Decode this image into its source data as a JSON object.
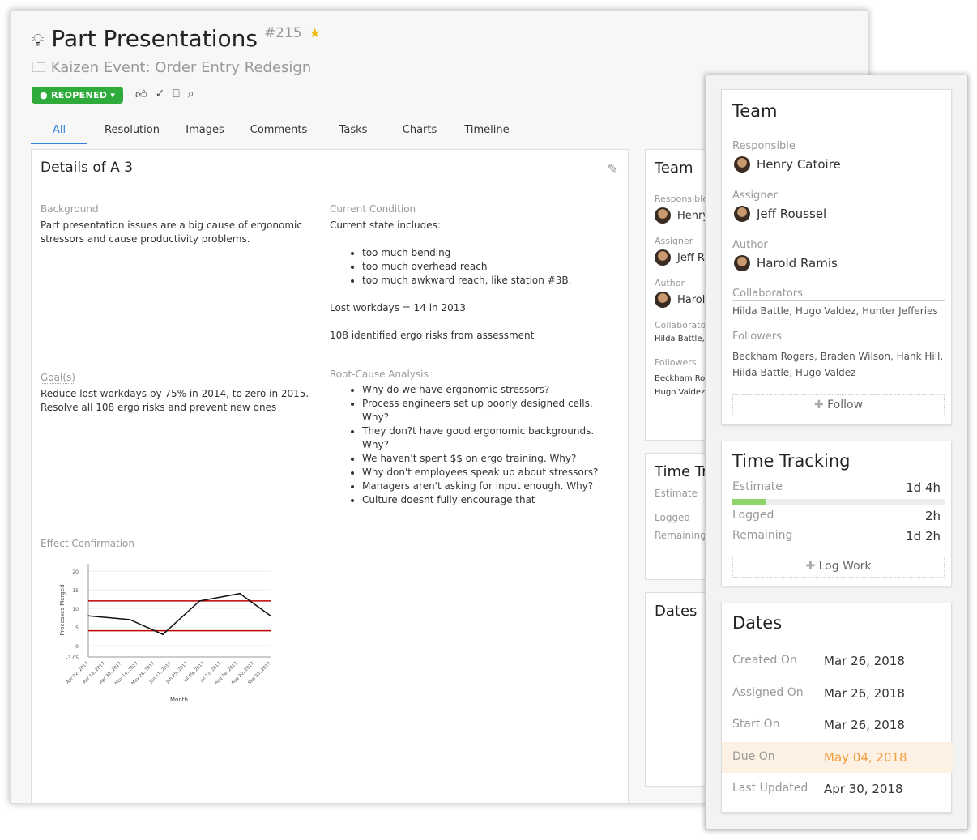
{
  "header": {
    "title": "Part Presentations",
    "number": "#215",
    "project": "Kaizen Event: Order Entry Redesign",
    "status": "REOPENED",
    "status_color": "#2eab3a"
  },
  "tabs": [
    {
      "label": "All",
      "active": true
    },
    {
      "label": "Resolution"
    },
    {
      "label": "Images"
    },
    {
      "label": "Comments"
    },
    {
      "label": "Tasks"
    },
    {
      "label": "Charts"
    },
    {
      "label": "Timeline"
    }
  ],
  "details": {
    "title": "Details of A 3",
    "background": {
      "label": "Background",
      "text": "Part presentation issues are a big cause of ergonomic stressors and cause productivity problems."
    },
    "current": {
      "label": "Current Condition",
      "intro": "Current state includes:",
      "items": [
        "too much bending",
        "too much overhead reach",
        "too much awkward reach, like station #3B."
      ],
      "p1": "Lost workdays = 14 in 2013",
      "p2": "108 identified ergo risks from assessment"
    },
    "goals": {
      "label": "Goal(s)",
      "lines": [
        "Reduce lost workdays by 75% in 2014, to zero in 2015.",
        "Resolve all 108 ergo risks and prevent new ones"
      ]
    },
    "root": {
      "label": "Root-Cause Analysis",
      "items": [
        "Why do we have ergonomic stressors?",
        "Process engineers set up poorly designed cells. Why?",
        "They don?t have good ergonomic backgrounds. Why?",
        "We haven't spent $$ on ergo training. Why?",
        "Why don't employees speak up about stressors?",
        "Managers aren't asking for input enough. Why?",
        "Culture doesnt fully encourage that"
      ]
    },
    "effect": {
      "label": "Effect Confirmation"
    }
  },
  "chart_data": {
    "type": "line",
    "xlabel": "Month",
    "ylabel": "Processes Merged",
    "ylim": [
      -3.05,
      22
    ],
    "yticks": [
      "20",
      "15",
      "10",
      "5",
      "0",
      "-3.05"
    ],
    "xticks": [
      "Apr 02, 2017",
      "Apr 16, 2017",
      "Apr 30, 2017",
      "May 14, 2017",
      "May 28, 2017",
      "Jun 11, 2017",
      "Jun 25, 2017",
      "Jul 09, 2017",
      "Jul 23, 2017",
      "Aug 06, 2017",
      "Aug 20, 2017",
      "Sep 03, 2017"
    ],
    "series": [
      {
        "x": [
          "2017-04-02",
          "2017-05-07",
          "2017-06-04",
          "2017-07-05",
          "2017-08-08",
          "2017-09-03"
        ],
        "y": [
          8,
          7,
          3,
          12,
          14,
          8
        ],
        "color": "#111111"
      }
    ],
    "limits": [
      {
        "y": 12,
        "color": "#c00000"
      },
      {
        "y": 4,
        "color": "#c00000"
      }
    ]
  },
  "team": {
    "title": "Team",
    "responsible_label": "Responsible",
    "responsible": "Henry Catoire",
    "assigner_label": "Assigner",
    "assigner": "Jeff Roussel",
    "author_label": "Author",
    "author": "Harold Ramis",
    "collab_label": "Collaborators",
    "collab": "Hilda Battle, Hugo Valdez, Hunter Jefferies",
    "followers_label": "Followers",
    "followers": "Beckham Rogers, Braden Wilson, Hank Hill, Hilda Battle, Hugo Valdez",
    "follow": "Follow"
  },
  "time": {
    "title": "Time Tracking",
    "estimate_label": "Estimate",
    "estimate": "1d 4h",
    "logged_label": "Logged",
    "logged": "2h",
    "remaining_label": "Remaining",
    "remaining": "1d 2h",
    "progress": 0.16,
    "bar_color": "#8ed46b",
    "log": "Log Work"
  },
  "dates": {
    "title": "Dates",
    "rows": [
      {
        "label": "Created On",
        "value": "Mar 26, 2018"
      },
      {
        "label": "Assigned On",
        "value": "Mar 26, 2018"
      },
      {
        "label": "Start On",
        "value": "Mar 26, 2018"
      },
      {
        "label": "Due On",
        "value": "May 04, 2018",
        "highlight": true
      },
      {
        "label": "Last Updated",
        "value": "Apr 30, 2018"
      }
    ],
    "due_color": "#f39c3c"
  }
}
